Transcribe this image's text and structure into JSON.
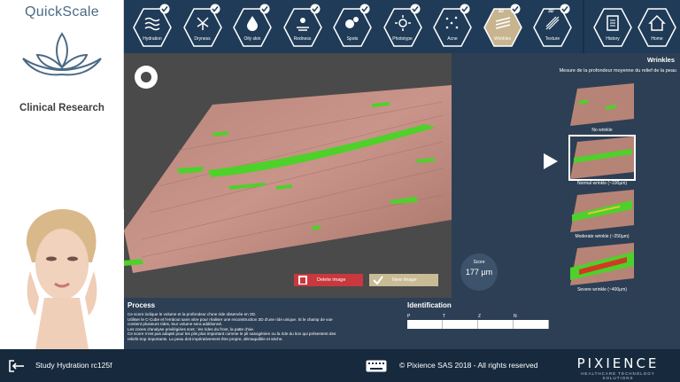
{
  "app": {
    "name": "QuickScale",
    "subtitle": "Clinical Research"
  },
  "tabs": [
    {
      "label": "Hydration",
      "icon": "waves-icon",
      "checked": true
    },
    {
      "label": "Dryness",
      "icon": "dry-cracks-icon",
      "checked": true
    },
    {
      "label": "Oily skin",
      "icon": "oil-drop-icon",
      "checked": true
    },
    {
      "label": "Redness",
      "icon": "redness-icon",
      "checked": true
    },
    {
      "label": "Spots",
      "icon": "spots-icon",
      "checked": true
    },
    {
      "label": "Phototype",
      "icon": "sun-icon",
      "checked": true
    },
    {
      "label": "Acne",
      "icon": "acne-dots-icon",
      "checked": true
    },
    {
      "label": "Wrinkles",
      "icon": "wrinkles-3d-icon",
      "checked": true,
      "active": true,
      "badge": "3D"
    },
    {
      "label": "Texture",
      "icon": "texture-3d-icon",
      "checked": true,
      "badge": "3D"
    }
  ],
  "nav": {
    "history": "History",
    "home": "Home"
  },
  "viewer": {
    "delete_label": "Delete image",
    "new_label": "New image"
  },
  "score": {
    "label": "Score",
    "value": "177 µm"
  },
  "panel": {
    "title": "Wrinkles",
    "description": "Mesure de la profondeur moyenne du relief de la peau",
    "levels": [
      {
        "label": "No wrinkle"
      },
      {
        "label": "Normal wrinkle (~100µm)",
        "selected": true
      },
      {
        "label": "Moderate wrinkle (~250µm)"
      },
      {
        "label": "Severe wrinkle (~400µm)"
      }
    ]
  },
  "process": {
    "heading": "Process",
    "lines": [
      "Ce score indique le volume et la profondeur d'une ride observée en 3D.",
      "Utiliser le C-Cube et l'embout sans vitre pour réaliser une reconstruction 3D d'une ride unique. Si le champ de vue",
      "contient plusieurs rides, leur volume sera additionné.",
      "Les zones d'analyse privilégiées sont : les rides du front, la patte d'oie.",
      "Ce score n'est pas adapté pour les plis plus important comme le pli nasogénien ou la ride du lion qui présentent des",
      "reliefs trop importants. La peau doit impérativement être propre, démaquillée et sèche."
    ]
  },
  "identification": {
    "heading": "Identification",
    "fields": [
      "P",
      "T",
      "Z",
      "N"
    ]
  },
  "footer": {
    "study": "Study Hydration rc125f",
    "copyright": "© Pixience SAS 2018 - All rights reserved",
    "logo": "PIXIENCE",
    "tagline": "HEALTHCARE TECHNOLOGY SOLUTIONS"
  },
  "colors": {
    "navy": "#1f3b57",
    "panel": "#2d3f54",
    "active_tab": "#c8b48f",
    "delete": "#c9383d",
    "wrinkle_green": "#4ed12a"
  }
}
